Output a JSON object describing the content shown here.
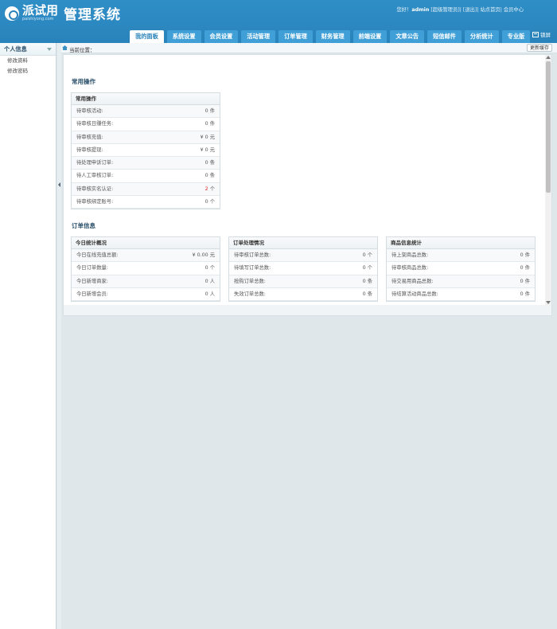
{
  "header": {
    "logo_name": "派试用",
    "logo_url": "paishiyong.com",
    "title": "管理系统",
    "greeting": "您好！",
    "username": "admin",
    "role": "[超级管理员]",
    "logout": "[退出]",
    "home_link": "站点首页",
    "member_center": "会员中心",
    "lock_label": "锁屏"
  },
  "nav": {
    "tabs": [
      {
        "label": "我的面板",
        "active": true
      },
      {
        "label": "系统设置"
      },
      {
        "label": "会员设置"
      },
      {
        "label": "活动管理"
      },
      {
        "label": "订单管理"
      },
      {
        "label": "财务管理"
      },
      {
        "label": "前端设置"
      },
      {
        "label": "文章公告"
      },
      {
        "label": "短信邮件"
      },
      {
        "label": "分析统计"
      },
      {
        "label": "专业版"
      }
    ]
  },
  "sidebar": {
    "title": "个人信息",
    "items": [
      {
        "label": "修改资料"
      },
      {
        "label": "修改密码"
      }
    ]
  },
  "breadcrumb": {
    "label": "当前位置：",
    "refresh": "更新缓存"
  },
  "sections": {
    "common": "常用操作",
    "orders": "订单信息"
  },
  "common_panel": {
    "title": "常用操作",
    "rows": [
      {
        "label": "待审核活动:",
        "num": "0",
        "unit": "件"
      },
      {
        "label": "待审核日赚任务:",
        "num": "0",
        "unit": "件"
      },
      {
        "label": "待审核充值:",
        "num": "¥ 0",
        "unit": "元"
      },
      {
        "label": "待审核提现:",
        "num": "¥ 0",
        "unit": "元"
      },
      {
        "label": "待处理申诉订单:",
        "num": "0",
        "unit": "条"
      },
      {
        "label": "待人工审核订单:",
        "num": "0",
        "unit": "条"
      },
      {
        "label": "待审核实名认证:",
        "num": "2",
        "unit": "个",
        "highlight": true
      },
      {
        "label": "待审核绑定账号:",
        "num": "0",
        "unit": "个"
      }
    ]
  },
  "order_panels": [
    {
      "title": "今日统计概况",
      "rows": [
        {
          "label": "今日在线充值总额:",
          "num": "¥ 0.00",
          "unit": "元"
        },
        {
          "label": "今日订单数量:",
          "num": "0",
          "unit": "个"
        },
        {
          "label": "今日新增商家:",
          "num": "0",
          "unit": "人"
        },
        {
          "label": "今日新增会员:",
          "num": "0",
          "unit": "人"
        }
      ]
    },
    {
      "title": "订单处理情况",
      "rows": [
        {
          "label": "待审核订单总数:",
          "num": "0",
          "unit": "个"
        },
        {
          "label": "待填写订单总数:",
          "num": "0",
          "unit": "个"
        },
        {
          "label": "抢购订单总数:",
          "num": "0",
          "unit": "条"
        },
        {
          "label": "失效订单总数:",
          "num": "0",
          "unit": "条"
        }
      ]
    },
    {
      "title": "商品信息统计",
      "rows": [
        {
          "label": "待上架商品总数:",
          "num": "0",
          "unit": "件"
        },
        {
          "label": "待审核商品总数:",
          "num": "0",
          "unit": "件"
        },
        {
          "label": "待交易用商品总数:",
          "num": "0",
          "unit": "件"
        },
        {
          "label": "待结算活动商品总数:",
          "num": "0",
          "unit": "件"
        }
      ]
    }
  ]
}
